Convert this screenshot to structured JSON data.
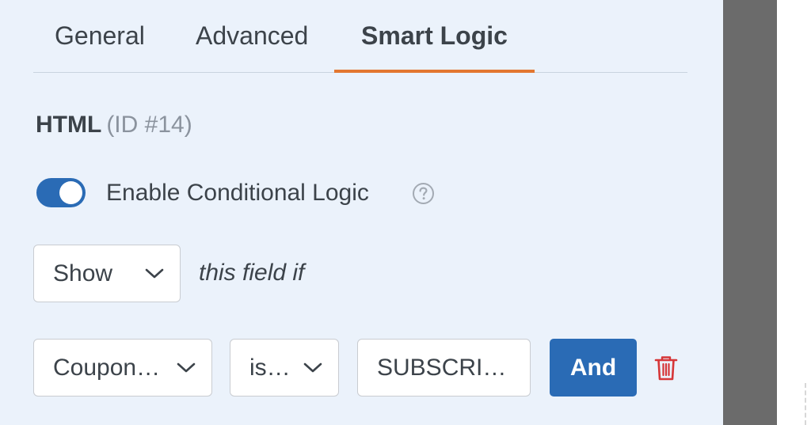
{
  "tabs": [
    {
      "label": "General",
      "active": false
    },
    {
      "label": "Advanced",
      "active": false
    },
    {
      "label": "Smart Logic",
      "active": true
    }
  ],
  "field": {
    "name": "HTML",
    "id_text": "(ID #14)"
  },
  "conditional": {
    "enabled": true,
    "label": "Enable Conditional Logic",
    "help_icon": "question-circle-icon"
  },
  "action": {
    "selected": "Show",
    "suffix_text": "this field if"
  },
  "rule": {
    "field_select": "Coupon…",
    "operator_select": "is…",
    "value": "SUBSCRI…",
    "and_button": "And",
    "delete_icon": "trash-icon"
  },
  "colors": {
    "panel_bg": "#ebf2fb",
    "accent": "#e27730",
    "primary": "#2a6bb5",
    "danger": "#d63638",
    "text": "#3c434a",
    "muted": "#8b939e"
  }
}
